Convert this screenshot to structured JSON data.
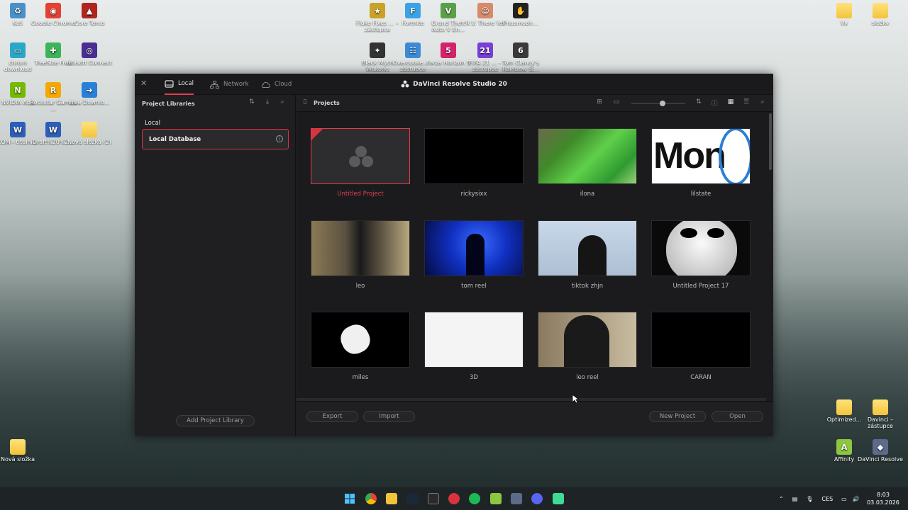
{
  "desktop": {
    "left_icons": [
      {
        "label": "Koš",
        "color": "#4a90c8",
        "glyph": "♻",
        "icon": "recycle-bin-icon"
      },
      {
        "label": "Google Chrome",
        "color": "#e34133",
        "glyph": "◉",
        "icon": "chrome-icon"
      },
      {
        "label": "Core Temp",
        "color": "#b0261f",
        "glyph": "▲",
        "icon": "core-temp-icon"
      },
      {
        "label": "chrom download",
        "color": "#2aa7c6",
        "glyph": "▭",
        "icon": "folder-download-icon"
      },
      {
        "label": "TreeSize Free",
        "color": "#3db45a",
        "glyph": "✚",
        "icon": "treesize-icon"
      },
      {
        "label": "Ubisoft Connect",
        "color": "#4b2e91",
        "glyph": "◎",
        "icon": "ubisoft-icon"
      },
      {
        "label": "NVIDIA App",
        "color": "#76b900",
        "glyph": "N",
        "icon": "nvidia-icon"
      },
      {
        "label": "Rockstar Games ...",
        "color": "#f5a800",
        "glyph": "R",
        "icon": "rockstar-icon"
      },
      {
        "label": "Free Downlo...",
        "color": "#2a7fd6",
        "glyph": "➜",
        "icon": "free-download-icon"
      },
      {
        "label": "KOM - titulní...",
        "color": "#2b5fb8",
        "glyph": "W",
        "icon": "word-doc-icon"
      },
      {
        "label": "Draft%20%2...",
        "color": "#2b5fb8",
        "glyph": "W",
        "icon": "word-doc-icon"
      },
      {
        "label": "Nová složka (2)",
        "color": "folder",
        "glyph": "",
        "icon": "folder-icon"
      }
    ],
    "top_icons": [
      {
        "label": "Flake Fixes ... – zástupce",
        "color": "#c9a227",
        "glyph": "★",
        "icon": "game-icon"
      },
      {
        "label": "Fortnite",
        "color": "#3aa3e8",
        "glyph": "F",
        "icon": "fortnite-icon"
      },
      {
        "label": "Grand Theft Auto V En...",
        "color": "#5aa04a",
        "glyph": "V",
        "icon": "gta-icon"
      },
      {
        "label": "R.V. There Yet",
        "color": "#d88a6a",
        "glyph": "☺",
        "icon": "game-icon"
      },
      {
        "label": "Phasmoph...",
        "color": "#222",
        "glyph": "✋",
        "icon": "phasmophobia-icon"
      },
      {
        "label": "Black Myth Wukong",
        "color": "#333",
        "glyph": "✦",
        "icon": "game-icon"
      },
      {
        "label": "Overcooke... – zástupce",
        "color": "#3d8bd6",
        "glyph": "☷",
        "icon": "overcooked-icon"
      },
      {
        "label": "Forza Horizon 5",
        "color": "#d6226a",
        "glyph": "5",
        "icon": "forza-icon"
      },
      {
        "label": "FIFA 21 ... – zástupce",
        "color": "#7a3fd6",
        "glyph": "21",
        "icon": "fifa-icon"
      },
      {
        "label": "Tom Clancy's Rainbow Si...",
        "color": "#3a3a3a",
        "glyph": "6",
        "icon": "rainbow-six-icon"
      }
    ],
    "right_icons": [
      {
        "label": "Vy",
        "color": "folder",
        "glyph": "",
        "icon": "folder-icon"
      },
      {
        "label": "složky",
        "color": "folder",
        "glyph": "",
        "icon": "folder-icon"
      },
      {
        "label": "Optimized...",
        "color": "folder",
        "glyph": "",
        "icon": "folder-icon"
      },
      {
        "label": "Davinci – zástupce",
        "color": "folder",
        "glyph": "",
        "icon": "folder-icon"
      },
      {
        "label": "Affinity",
        "color": "#8dc63f",
        "glyph": "A",
        "icon": "affinity-icon"
      },
      {
        "label": "DaVinci Resolve",
        "color": "#5c6b8a",
        "glyph": "◆",
        "icon": "davinci-icon"
      },
      {
        "label": "Nová složka",
        "color": "folder",
        "glyph": "",
        "icon": "folder-icon"
      }
    ]
  },
  "window": {
    "title": "DaVinci Resolve Studio 20",
    "tabs": [
      {
        "label": "Local",
        "active": true
      },
      {
        "label": "Network",
        "active": false
      },
      {
        "label": "Cloud",
        "active": false
      }
    ],
    "left_panel": {
      "header": "Project Libraries",
      "section": "Local",
      "database": "Local Database",
      "add_button": "Add Project Library"
    },
    "right_panel": {
      "header": "Projects",
      "projects": [
        {
          "name": "Untitled Project",
          "selected": true,
          "thumb": "placeholder"
        },
        {
          "name": "rickysixx",
          "thumb": "black"
        },
        {
          "name": "ilona",
          "thumb": "green"
        },
        {
          "name": "lilstate",
          "thumb": "money",
          "text": "Mon"
        },
        {
          "name": "leo",
          "thumb": "street"
        },
        {
          "name": "tom reel",
          "thumb": "blue"
        },
        {
          "name": "tiktok zhjn",
          "thumb": "silhouette"
        },
        {
          "name": "Untitled Project 17",
          "thumb": "mask"
        },
        {
          "name": "miles",
          "thumb": "miles"
        },
        {
          "name": "3D",
          "thumb": "white"
        },
        {
          "name": "leo reel",
          "thumb": "hoodie"
        },
        {
          "name": "CARAN",
          "thumb": "black"
        }
      ],
      "buttons": {
        "export": "Export",
        "import": "Import",
        "new_project": "New Project",
        "open": "Open"
      }
    }
  },
  "taskbar": {
    "language": "CES",
    "time": "8:03",
    "date": "03.03.2026"
  }
}
